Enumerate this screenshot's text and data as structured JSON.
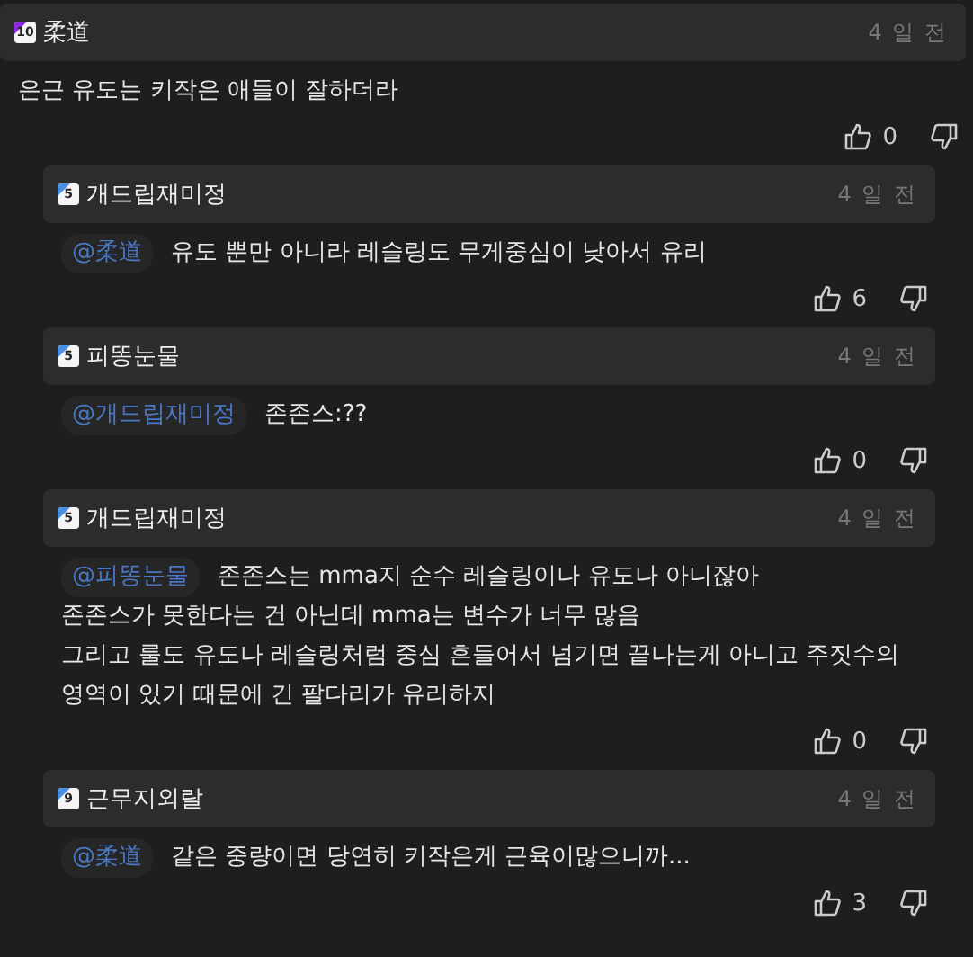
{
  "comment": {
    "author": "柔道",
    "badge": "10",
    "color": "#8a2be2",
    "time": "4 일 전",
    "text": "은근 유도는 키작은 애들이 잘하더라",
    "likes": "0",
    "children": [
      {
        "author": "개드립재미정",
        "badge": "5",
        "color": "#4a90e2",
        "time": "4 일 전",
        "mention": "@柔道",
        "text": "유도 뿐만 아니라 레슬링도 무게중심이 낮아서 유리",
        "likes": "6"
      },
      {
        "author": "피똥눈물",
        "badge": "5",
        "color": "#4a90e2",
        "time": "4 일 전",
        "mention": "@개드립재미정",
        "text": "존존스:??",
        "likes": "0"
      },
      {
        "author": "개드립재미정",
        "badge": "5",
        "color": "#4a90e2",
        "time": "4 일 전",
        "mention": "@피똥눈물",
        "text": "존존스는 mma지 순수 레슬링이나 유도나 아니잖아",
        "more_text": "존존스가 못한다는 건 아닌데 mma는 변수가 너무 많음\n그리고 룰도 유도나 레슬링처럼 중심 흔들어서 넘기면 끝나는게 아니고 주짓수의 영역이 있기 때문에 긴 팔다리가 유리하지",
        "likes": "0"
      },
      {
        "author": "근무지외랄",
        "badge": "9",
        "color": "#4a90e2",
        "time": "4 일 전",
        "mention": "@柔道",
        "text": "같은 중량이면 당연히 키작은게 근육이많으니까...",
        "likes": "3"
      }
    ]
  }
}
